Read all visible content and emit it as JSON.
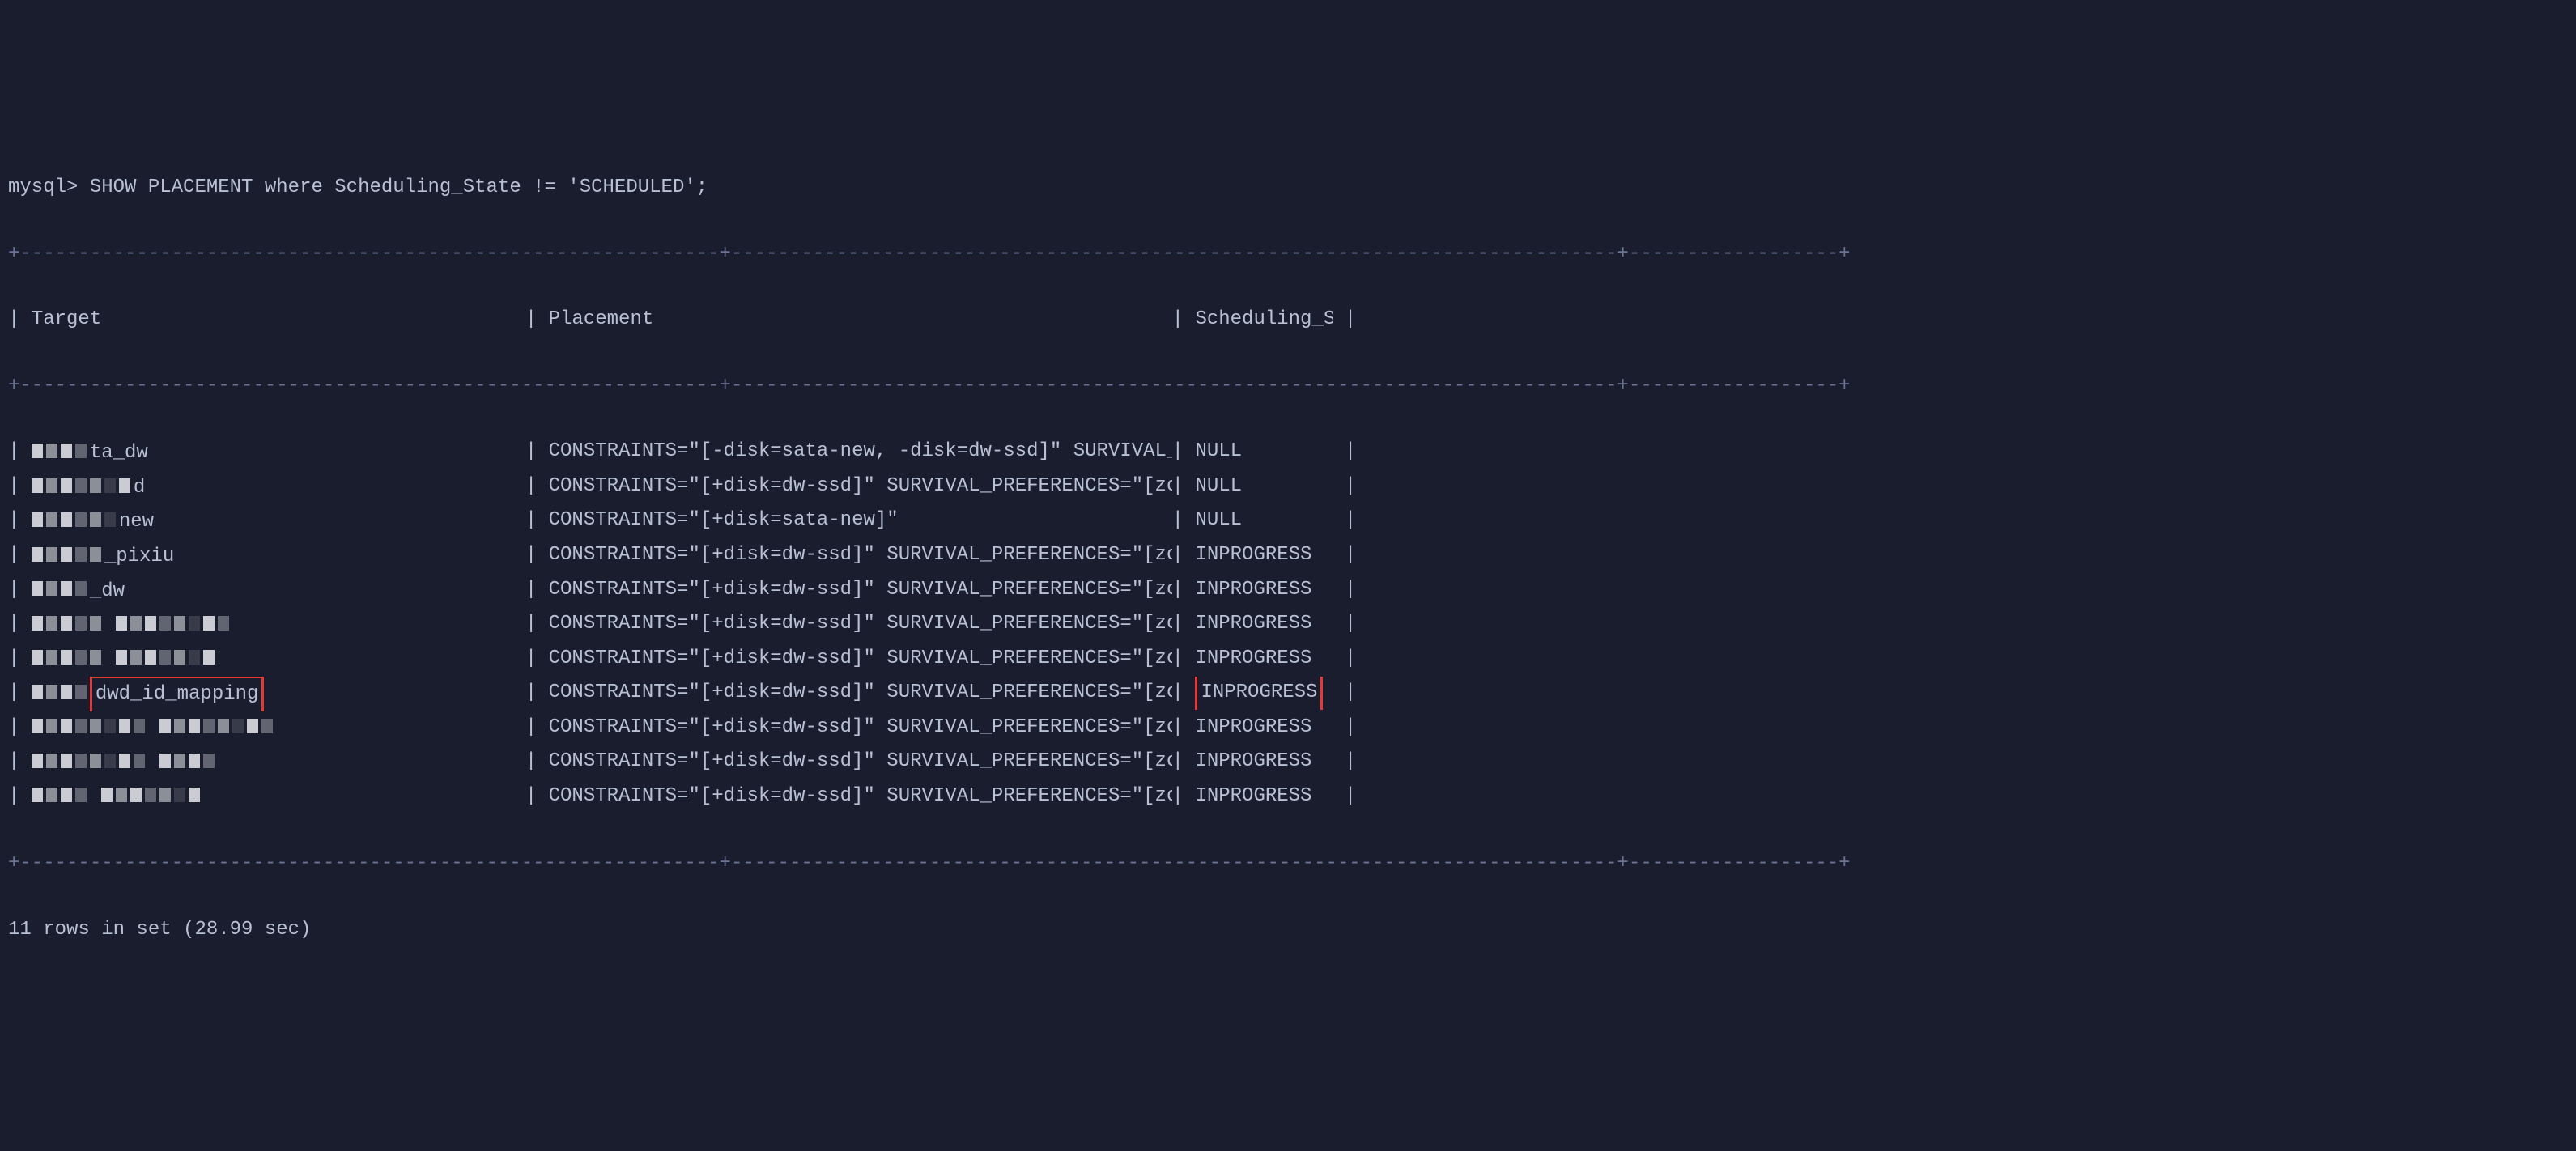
{
  "prompt": "mysql>",
  "query": "SHOW PLACEMENT where Scheduling_State != 'SCHEDULED';",
  "headers": {
    "target": "Target",
    "placement": "Placement",
    "scheduling_state": "Scheduling_State"
  },
  "divider_top": "+------------------------------------------------------------+----------------------------------------------------------------------------+------------------+",
  "divider_mid": "+------------------------------------------------------------+----------------------------------------------------------------------------+------------------+",
  "divider_bottom": "+------------------------------------------------------------+----------------------------------------------------------------------------+------------------+",
  "rows": [
    {
      "target_suffix": "ta_dw",
      "placement": "CONSTRAINTS=\"[-disk=sata-new, -disk=dw-ssd]\" SURVIVAL_PREFERENCES=\"[zone, dc, host]\"",
      "state": "NULL",
      "highlight_target": false,
      "highlight_state": false
    },
    {
      "target_suffix": "d",
      "placement": "CONSTRAINTS=\"[+disk=dw-ssd]\" SURVIVAL_PREFERENCES=\"[zone, dc, host]\"",
      "state": "NULL",
      "highlight_target": false,
      "highlight_state": false
    },
    {
      "target_suffix": "new",
      "placement": "CONSTRAINTS=\"[+disk=sata-new]\"",
      "state": "NULL",
      "highlight_target": false,
      "highlight_state": false
    },
    {
      "target_suffix": "_pixiu",
      "placement": "CONSTRAINTS=\"[+disk=dw-ssd]\" SURVIVAL_PREFERENCES=\"[zone, dc, host]\"",
      "state": "INPROGRESS",
      "highlight_target": false,
      "highlight_state": false
    },
    {
      "target_suffix": "_dw",
      "placement": "CONSTRAINTS=\"[+disk=dw-ssd]\" SURVIVAL_PREFERENCES=\"[zone, dc, host]\"",
      "state": "INPROGRESS",
      "highlight_target": false,
      "highlight_state": false
    },
    {
      "target_suffix": "",
      "placement": "CONSTRAINTS=\"[+disk=dw-ssd]\" SURVIVAL_PREFERENCES=\"[zone, dc, host]\"",
      "state": "INPROGRESS",
      "highlight_target": false,
      "highlight_state": false
    },
    {
      "target_suffix": "",
      "placement": "CONSTRAINTS=\"[+disk=dw-ssd]\" SURVIVAL_PREFERENCES=\"[zone, dc, host]\"",
      "state": "INPROGRESS",
      "highlight_target": false,
      "highlight_state": false
    },
    {
      "target_suffix": "dwd_id_mapping",
      "placement": "CONSTRAINTS=\"[+disk=dw-ssd]\" SURVIVAL_PREFERENCES=\"[zone, dc, host]\"",
      "state": "INPROGRESS",
      "highlight_target": true,
      "highlight_state": true
    },
    {
      "target_suffix": "",
      "placement": "CONSTRAINTS=\"[+disk=dw-ssd]\" SURVIVAL_PREFERENCES=\"[zone, dc, host]\"",
      "state": "INPROGRESS",
      "highlight_target": false,
      "highlight_state": false
    },
    {
      "target_suffix": "",
      "placement": "CONSTRAINTS=\"[+disk=dw-ssd]\" SURVIVAL_PREFERENCES=\"[zone, dc, host]\"",
      "state": "INPROGRESS",
      "highlight_target": false,
      "highlight_state": false
    },
    {
      "target_suffix": "",
      "placement": "CONSTRAINTS=\"[+disk=dw-ssd]\" SURVIVAL_PREFERENCES=\"[zone, dc, host]\"",
      "state": "INPROGRESS",
      "highlight_target": false,
      "highlight_state": false
    }
  ],
  "footer": "11 rows in set (28.99 sec)"
}
